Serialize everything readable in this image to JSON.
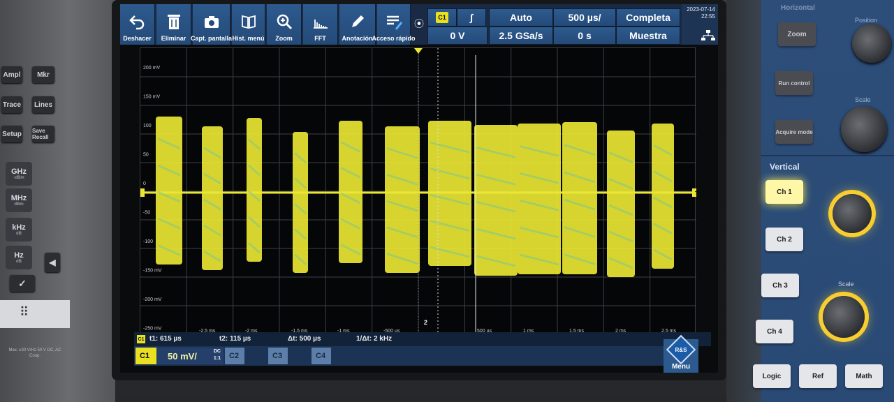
{
  "toolbar": {
    "buttons": [
      {
        "label": "Deshacer",
        "icon": "undo-icon"
      },
      {
        "label": "Eliminar",
        "icon": "trash-icon"
      },
      {
        "label": "Capt. pantalla",
        "icon": "camera-icon"
      },
      {
        "label": "Hist. menú",
        "icon": "book-icon"
      },
      {
        "label": "Zoom",
        "icon": "zoom-icon"
      },
      {
        "label": "FFT",
        "icon": "fft-icon"
      },
      {
        "label": "Anotación",
        "icon": "pencil-icon"
      },
      {
        "label": "Acceso rápido",
        "icon": "quick-access-icon"
      }
    ],
    "channel_badge": "C1",
    "trigger_badge": "∫",
    "trigger_level": "0 V",
    "trigger_mode": "Auto",
    "sample_rate": "2.5 GSa/s",
    "timebase": "500 µs/",
    "time_offset": "0 s",
    "acq_mode": "Completa",
    "acq_type": "Muestra",
    "date": "2023-07-14",
    "time": "22:55"
  },
  "plot": {
    "y_labels": [
      "200 mV",
      "150 mV",
      "100",
      "50",
      "0",
      "-50",
      "-100",
      "-150 mV",
      "-200 mV",
      "-250 mV"
    ],
    "x_labels": [
      "-2.5 ms",
      "-2 ms",
      "-1.5 ms",
      "-1 ms",
      "-500 µs",
      "500 µs",
      "1 ms",
      "1.5 ms",
      "2 ms",
      "2.5 ms"
    ],
    "left_marker": "C1",
    "right_marker": "TL",
    "cursor2_label": "2",
    "signal_color": "#e9e634"
  },
  "cursors": {
    "t1": "t1: 615 µs",
    "t2": "t2: 115 µs",
    "dt": "Δt: 500 µs",
    "inv_dt": "1/Δt: 2 kHz"
  },
  "channels": {
    "c1_label": "C1",
    "c1_scale": "50 mV/",
    "c1_coupling_top": "DC",
    "c1_coupling_bottom": "1:1",
    "c2_label": "C2",
    "c3_label": "C3",
    "c4_label": "C4",
    "menu_label": "Menu",
    "logo": "R&S"
  },
  "left_panel": {
    "buttons": [
      "Ampl",
      "Mkr",
      "Trace",
      "Lines",
      "Setup",
      "Save Recall"
    ],
    "freq_buttons": [
      {
        "label": "GHz",
        "sub": "-dBm"
      },
      {
        "label": "MHz",
        "sub": "dBm"
      },
      {
        "label": "kHz",
        "sub": "dB"
      },
      {
        "label": "Hz",
        "sub": "dB"
      }
    ],
    "warning": "Max. ±30 V/Hz 50 V DC, AC Coup."
  },
  "right_panel": {
    "horizontal_title": "Horizontal",
    "position_label": "Position",
    "zoom_label": "Zoom",
    "run_label": "Run control",
    "acquire_label": "Acquire mode",
    "scale_label_top": "Scale",
    "vertical_title": "Vertical",
    "ch1": "Ch 1",
    "ch2": "Ch 2",
    "ch3": "Ch 3",
    "ch4": "Ch 4",
    "scale_label": "Scale",
    "logic": "Logic",
    "ref": "Ref",
    "math": "Math"
  }
}
